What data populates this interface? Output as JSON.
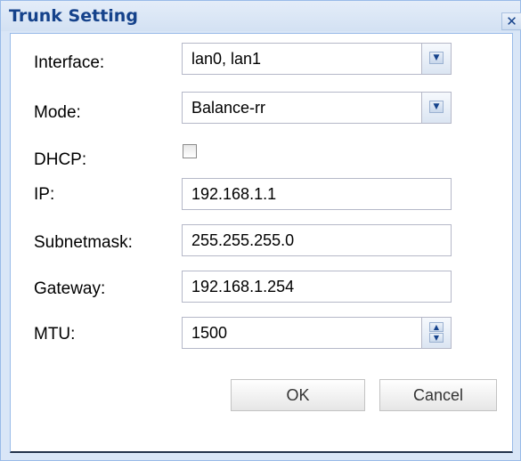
{
  "dialog": {
    "title": "Trunk Setting",
    "close_glyph": "✕"
  },
  "form": {
    "interface_label": "Interface:",
    "interface_value": "lan0, lan1",
    "mode_label": "Mode:",
    "mode_value": "Balance-rr",
    "dhcp_label": "DHCP:",
    "dhcp_checked": false,
    "ip_label": "IP:",
    "ip_value": "192.168.1.1",
    "subnet_label": "Subnetmask:",
    "subnet_value": "255.255.255.0",
    "gateway_label": "Gateway:",
    "gateway_value": "192.168.1.254",
    "mtu_label": "MTU:",
    "mtu_value": "1500"
  },
  "buttons": {
    "ok": "OK",
    "cancel": "Cancel"
  },
  "icons": {
    "dropdown": "chevron-down-icon",
    "spin_up": "chevron-up-icon",
    "spin_down": "chevron-down-icon",
    "close": "close-icon"
  }
}
